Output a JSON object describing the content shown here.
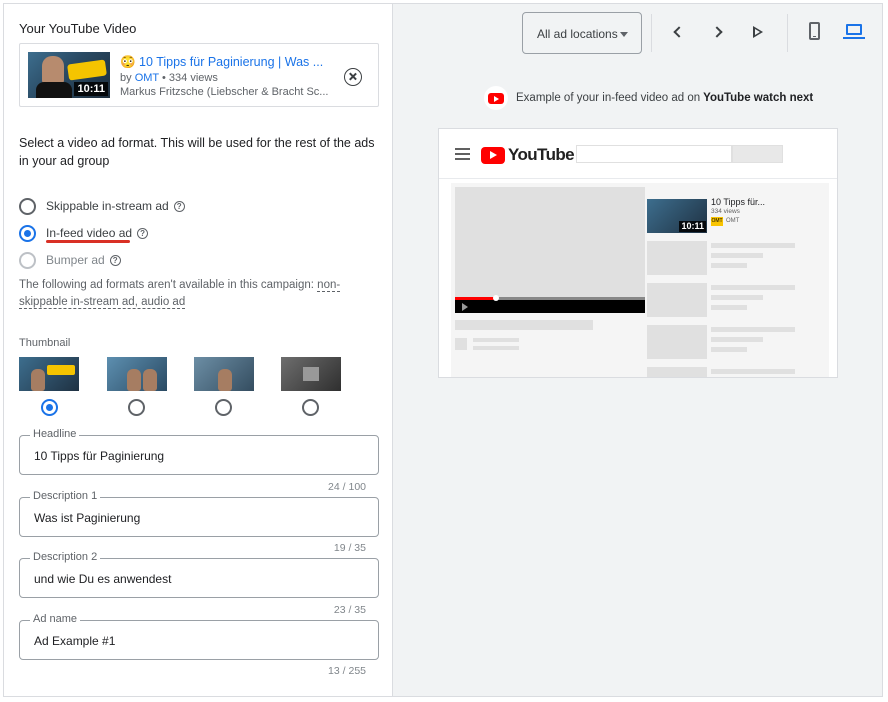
{
  "left": {
    "section_title": "Your YouTube Video",
    "video": {
      "title": "😳 10 Tipps für Paginierung | Was ...",
      "by": "by",
      "channel": "OMT",
      "views": "• 334 views",
      "owner": "Markus Fritzsche (Liebscher & Bracht Sc...",
      "duration": "10:11"
    },
    "format_prompt": "Select a video ad format. This will be used for the rest of the ads in your ad group",
    "formats": [
      {
        "label": "Skippable in-stream ad",
        "state": "unselected"
      },
      {
        "label": "In-feed video ad",
        "state": "selected"
      },
      {
        "label": "Bumper ad",
        "state": "disabled"
      }
    ],
    "help_glyph": "?",
    "unavailable_prefix": "The following ad formats aren't available in this campaign:",
    "unavailable_formats": "non-skippable in-stream ad, audio ad",
    "thumbnail_label": "Thumbnail",
    "thumbnail_selected_index": 0,
    "fields": [
      {
        "label": "Headline",
        "value": "10 Tipps für Paginierung",
        "counter": "24 / 100"
      },
      {
        "label": "Description 1",
        "value": "Was ist Paginierung",
        "counter": "19 / 35"
      },
      {
        "label": "Description 2",
        "value": "und wie Du es anwendest",
        "counter": "23 / 35"
      },
      {
        "label": "Ad name",
        "value": "Ad Example #1",
        "counter": "13 / 255"
      }
    ]
  },
  "right": {
    "location_select": "All ad locations",
    "example_text": "Example of your in-feed video ad on",
    "example_bold": "YouTube watch next",
    "mock": {
      "logo_text": "YouTube",
      "ad_title": "10 Tipps für...",
      "ad_views": "334 views",
      "ad_channel": "OMT",
      "ad_badge": "OMT",
      "ad_duration": "10:11"
    }
  },
  "colors": {
    "accent": "#1a73e8",
    "annotation_red": "#d93025",
    "youtube_red": "#ff0000",
    "panel_bg": "#f1f3f4"
  }
}
